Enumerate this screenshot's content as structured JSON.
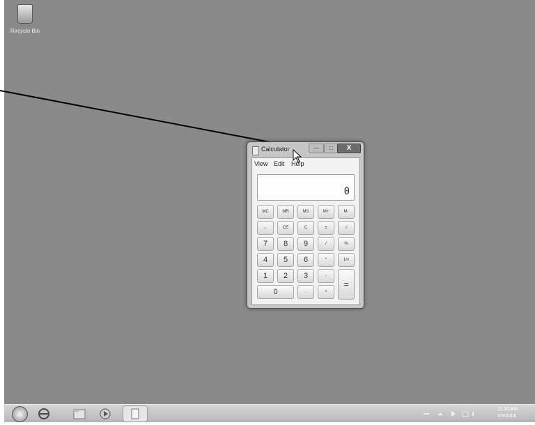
{
  "desktop": {
    "icons": [
      {
        "label": "Recycle Bin"
      }
    ]
  },
  "calculator": {
    "title": "Calculator",
    "window_buttons": {
      "minimize": "—",
      "maximize": "□",
      "close": "X"
    },
    "menu": [
      "View",
      "Edit",
      "Help"
    ],
    "display": "0",
    "keys": {
      "memory": [
        "MC",
        "MR",
        "MS",
        "M+",
        "M-"
      ],
      "row2": [
        "←",
        "CE",
        "C",
        "±",
        "√"
      ],
      "row3": [
        "7",
        "8",
        "9",
        "/",
        "%"
      ],
      "row4": [
        "4",
        "5",
        "6",
        "*",
        "1/x"
      ],
      "row5": [
        "1",
        "2",
        "3",
        "-"
      ],
      "row6": [
        "0",
        ".",
        "+"
      ],
      "equals": "="
    }
  },
  "taskbar": {
    "items": [
      "start-orb",
      "internet-explorer-icon",
      "windows-explorer-icon",
      "media-player-icon",
      "calculator-icon"
    ],
    "tray": {
      "time": "11:30 AM",
      "date": "9/3/2009"
    }
  }
}
